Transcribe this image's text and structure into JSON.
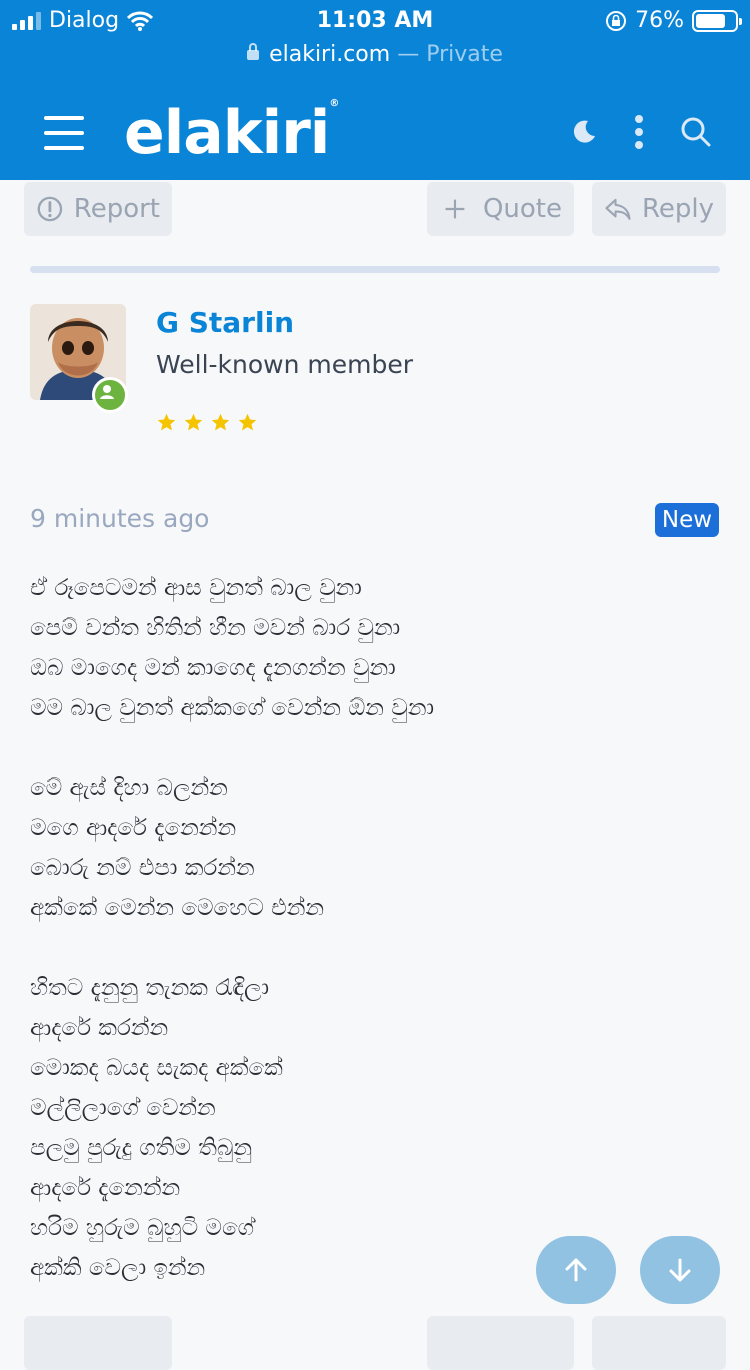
{
  "status_bar": {
    "carrier": "Dialog",
    "time": "11:03 AM",
    "battery_percent": "76%",
    "battery_level": 0.76
  },
  "url_bar": {
    "domain": "elakiri.com",
    "mode": "— Private"
  },
  "navbar": {
    "logo_text": "elakiri",
    "icons": [
      "menu-icon",
      "moon-icon",
      "more-vertical-icon",
      "search-icon"
    ]
  },
  "post_actions_top": {
    "report": "Report",
    "quote": "Quote",
    "reply": "Reply"
  },
  "post": {
    "author": "G Starlin",
    "author_title": "Well-known member",
    "star_count": 4,
    "time_ago": "9 minutes ago",
    "badge": "New",
    "lines": [
      "ඒ රූපෙටමන් ආස වුනත් බාල වුනා",
      "පෙම් වන්ත හිතින් හීන මවන් බාර වුනා",
      "ඔබ මාගෙද මන් කාගෙද දැනගන්න වුනා",
      "මම බාල වුනත් අක්කගේ වෙන්න ඕන වුනා",
      "",
      "මේ ඇස් දිහා බලන්න",
      "මගෙ ආදරේ දැනෙන්න",
      "බොරු නම් එපා කරන්න",
      "අක්කේ මෙන්න මෙහෙට එන්න",
      "",
      "හිතට දැනුනු තැනක රැඳිලා",
      "ආදරේ කරන්න",
      "මොකද බයද සැකද අක්කේ",
      "මල්ලිලාගේ වෙන්න",
      "පලමු පුරුදු ගතිම තිබුනු",
      "ආදරේ දැනෙන්න",
      "හරිම හුරුම බුහුටි මගේ",
      "අක්කි වෙලා ඉන්න"
    ]
  },
  "colors": {
    "header_bg": "#0a84d6",
    "accent": "#0a84d6",
    "badge_bg": "#1c6fd9",
    "online": "#6db33f",
    "star": "#f5c400"
  },
  "fabs": [
    "scroll-up-icon",
    "scroll-down-icon"
  ]
}
